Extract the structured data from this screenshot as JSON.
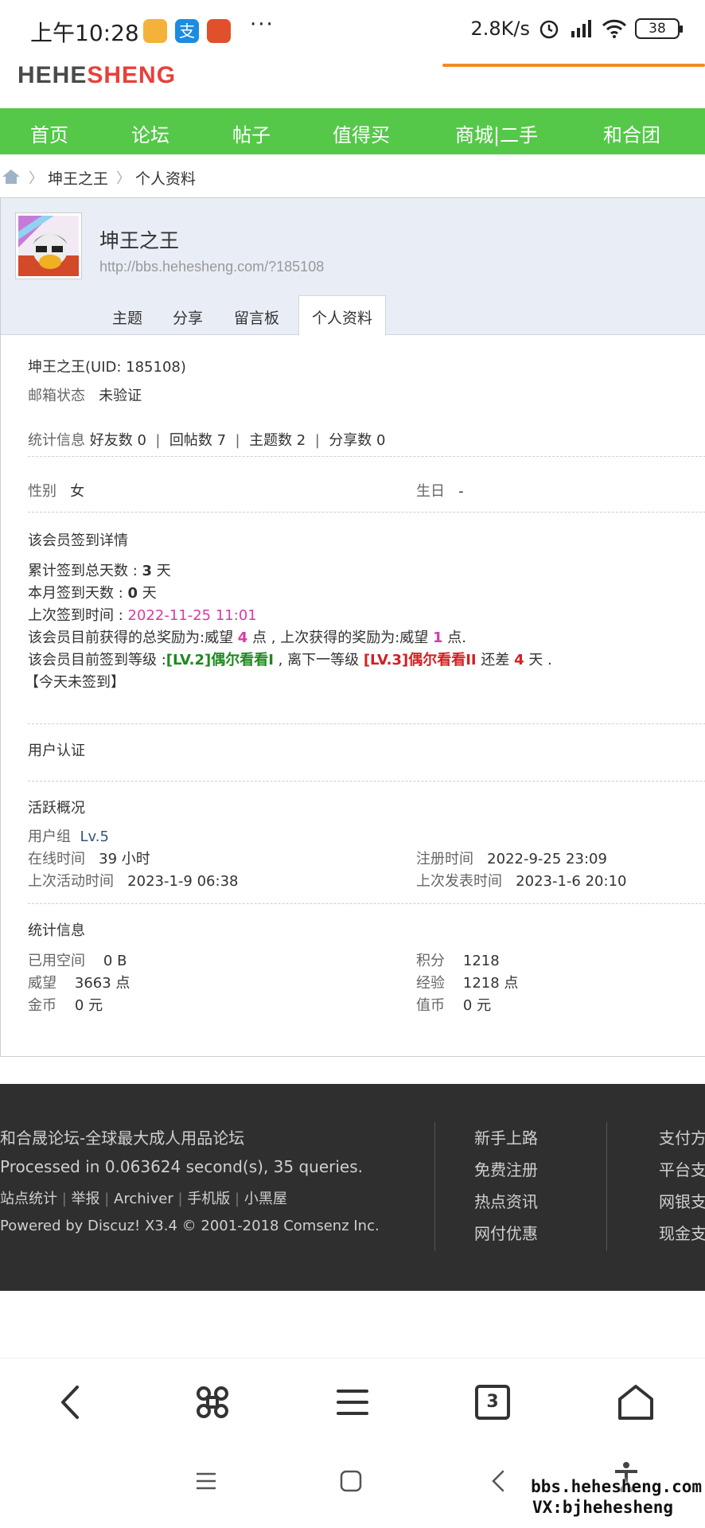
{
  "status_bar": {
    "time": "上午10:28",
    "dots": "···",
    "net_speed": "2.8K/s",
    "battery": "38"
  },
  "site": {
    "logo_part1": "HEHE",
    "logo_part2": "SHENG"
  },
  "nav": [
    "首页",
    "论坛",
    "帖子",
    "值得买",
    "商城|二手",
    "和合团"
  ],
  "breadcrumb": [
    "坤王之王",
    "个人资料"
  ],
  "profile": {
    "name": "坤王之王",
    "url": "http://bbs.hehesheng.com/?185108",
    "tabs": [
      "主题",
      "分享",
      "留言板",
      "个人资料"
    ],
    "active_tab": "个人资料"
  },
  "basic": {
    "name_uid": "坤王之王(UID: 185108)",
    "email_label": "邮箱状态",
    "email_value": "未验证",
    "stats_label": "统计信息",
    "friends": "好友数 0",
    "replies": "回帖数 7",
    "threads": "主题数 2",
    "shares": "分享数 0",
    "gender_label": "性别",
    "gender_value": "女",
    "birthday_label": "生日",
    "birthday_value": "-"
  },
  "signin": {
    "title": "该会员签到详情",
    "total_label": "累计签到总天数 : ",
    "total_value": "3",
    "total_unit": " 天",
    "month_label": "本月签到天数 : ",
    "month_value": "0",
    "month_unit": " 天",
    "last_label": "上次签到时间 : ",
    "last_value": "2022-11-25 11:01",
    "reward_pre": "该会员目前获得的总奖励为:威望 ",
    "reward_total": "4",
    "reward_mid": " 点 , 上次获得的奖励为:威望 ",
    "reward_last": "1",
    "reward_post": " 点.",
    "level_pre": "该会员目前签到等级 :",
    "level_current": "[LV.2]偶尔看看I",
    "level_mid": " , 离下一等级 ",
    "level_next": "[LV.3]偶尔看看II",
    "level_post1": " 还差 ",
    "level_diff": "4",
    "level_post2": " 天 .",
    "today": "【今天未签到】"
  },
  "auth": {
    "title": "用户认证"
  },
  "activity": {
    "title": "活跃概况",
    "group_label": "用户组",
    "group_value": "Lv.5",
    "online_label": "在线时间",
    "online_value": "39 小时",
    "reg_label": "注册时间",
    "reg_value": "2022-9-25 23:09",
    "last_active_label": "上次活动时间",
    "last_active_value": "2023-1-9 06:38",
    "last_post_label": "上次发表时间",
    "last_post_value": "2023-1-6 20:10"
  },
  "stats": {
    "title": "统计信息",
    "space_label": "已用空间",
    "space_value": "0 B",
    "points_label": "积分",
    "points_value": "1218",
    "prestige_label": "威望",
    "prestige_value": "3663 点",
    "exp_label": "经验",
    "exp_value": "1218 点",
    "gold_label": "金币",
    "gold_value": "0 元",
    "coin_label": "值币",
    "coin_value": "0 元"
  },
  "footer": {
    "site_name": "和合晟论坛-全球最大成人用品论坛",
    "processed": "Processed in 0.063624 second(s), 35 queries.",
    "links": [
      "站点统计",
      "举报",
      "Archiver",
      "手机版",
      "小黑屋"
    ],
    "powered": "Powered by Discuz! X3.4 © 2001-2018 Comsenz Inc.",
    "col2": [
      "新手上路",
      "免费注册",
      "热点资讯",
      "网付优惠"
    ],
    "col3": [
      "支付方",
      "平台支",
      "网银支",
      "现金支"
    ]
  },
  "browser": {
    "tab_count": "3"
  },
  "watermark": {
    "line1": "bbs.hehesheng.com",
    "line2": "VX:bjhehesheng"
  },
  "colors": {
    "nav_green": "#55c84a",
    "logo_red": "#e8403a",
    "accent_orange": "#f08a24",
    "footer_bg": "#2f2f2f",
    "pink_date": "#d63ca8",
    "level_green": "#1d8a1d",
    "level_red": "#d22020"
  }
}
